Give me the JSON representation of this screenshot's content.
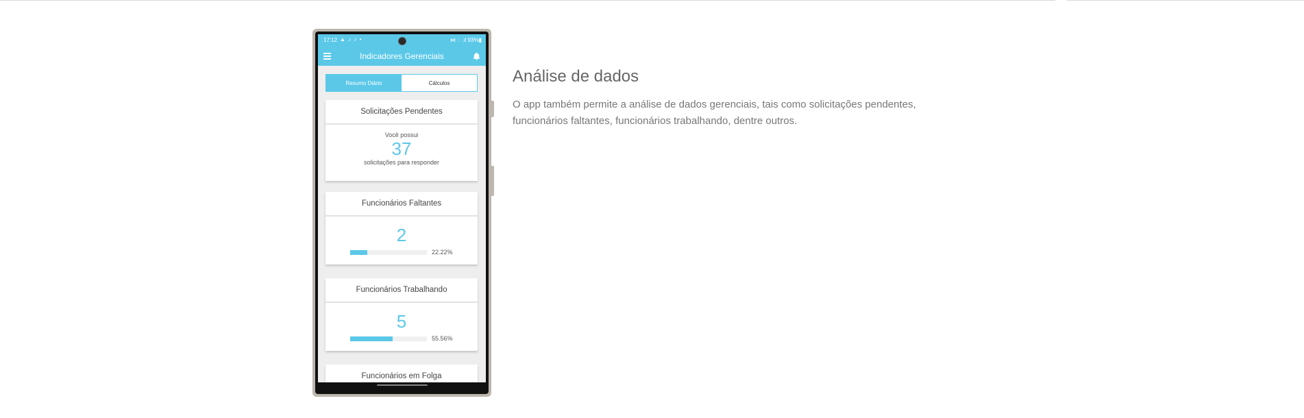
{
  "colors": {
    "accent": "#5bc8e8",
    "heading": "#666666",
    "body_text": "#777777"
  },
  "phone": {
    "status_bar": {
      "time": "17:12",
      "left_icons": "▲ ♪ ♪ •",
      "right": "⋈ ◌ .ıl 93%▮"
    },
    "app_bar": {
      "title": "Indicadores Gerenciais",
      "menu_icon": "hamburger-menu-icon",
      "bell_icon": "bell-icon"
    },
    "tabs": [
      {
        "label": "Resumo Diário",
        "active": true
      },
      {
        "label": "Cálculos",
        "active": false
      }
    ],
    "cards": {
      "pending": {
        "title": "Solicitações Pendentes",
        "prefix": "Você possui",
        "value": "37",
        "suffix": "solicitações para responder"
      },
      "missing": {
        "title": "Funcionários Faltantes",
        "value": "2",
        "percent_label": "22.22%",
        "percent": 22.22
      },
      "working": {
        "title": "Funcionários Trabalhando",
        "value": "5",
        "percent_label": "55.56%",
        "percent": 55.56
      },
      "off": {
        "title": "Funcionários em Folga"
      }
    }
  },
  "section": {
    "heading": "Análise de dados",
    "description": "O app também permite a análise de dados gerenciais, tais como solicitações pendentes, funcionários faltantes, funcionários trabalhando, dentre outros."
  }
}
